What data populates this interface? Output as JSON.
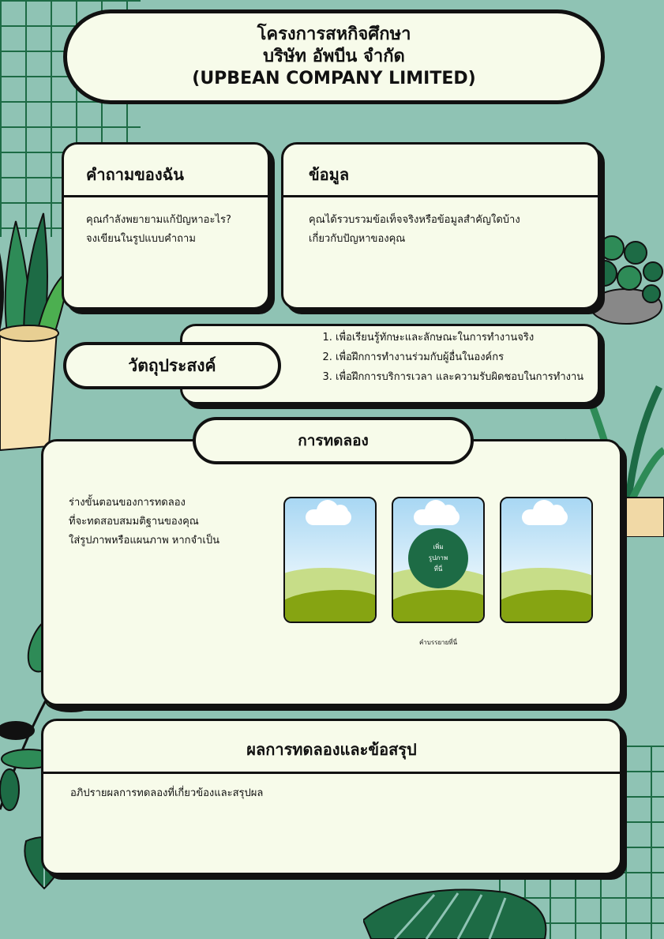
{
  "header": {
    "line1": "โครงการสหกิจศึกษา",
    "line2": "บริษัท อัพบีน จำกัด",
    "line3": "(UPBEAN COMPANY LIMITED)"
  },
  "question": {
    "title": "คำถามของฉัน",
    "line1": "คุณกำลังพยายามแก้ปัญหาอะไร?",
    "line2": "จงเขียนในรูปแบบคำถาม"
  },
  "info": {
    "title": "ข้อมูล",
    "line1": "คุณได้รวบรวมข้อเท็จจริงหรือข้อมูลสำคัญใดบ้าง",
    "line2": "เกี่ยวกับปัญหาของคุณ"
  },
  "objective": {
    "title": "วัตถุประสงค์",
    "items": [
      "เพื่อเรียนรู้ทักษะและลักษณะในการทำงานจริง",
      "เพื่อฝึกการทำงานร่วมกับผู้อื่นในองค์กร",
      "เพื่อฝึกการบริการเวลา และความรับผิดชอบในการทำงาน"
    ]
  },
  "experiment": {
    "title": "การทดลอง",
    "line1": "ร่างขั้นตอนของการทดลอง",
    "line2": "ที่จะทดสอบสมมติฐานของคุณ",
    "line3": "ใส่รูปภาพหรือแผนภาพ หากจำเป็น",
    "photo_badge": [
      "เพิ่ม",
      "รูปภาพ",
      "ที่นี่"
    ],
    "caption": "คำบรรยายที่นี่"
  },
  "results": {
    "title": "ผลการทดลองและข้อสรุป",
    "text": "อภิปรายผลการทดลองที่เกี่ยวข้องและสรุปผล"
  },
  "colors": {
    "background": "#8fc3b4",
    "card": "#f7fbea",
    "accent_green": "#1d6b45"
  }
}
